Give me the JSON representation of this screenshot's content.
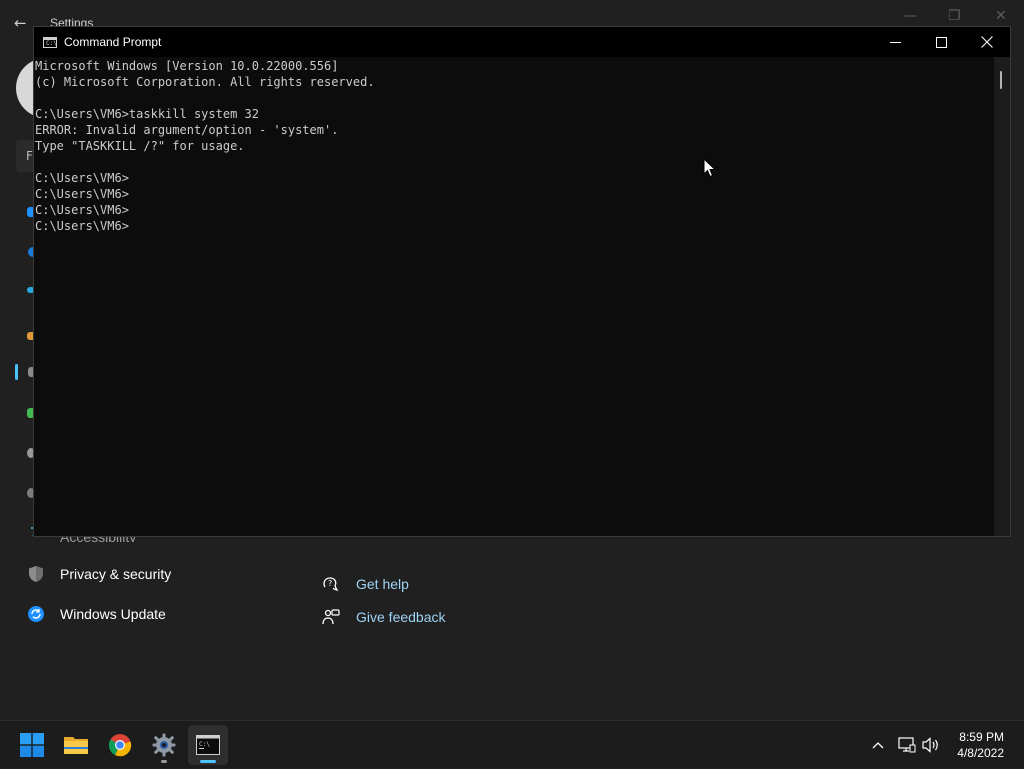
{
  "settings": {
    "title": "Settings",
    "nav": {
      "accessibility_partial": "Accessibility",
      "privacy": "Privacy & security",
      "windows_update": "Windows Update"
    },
    "find_placeholder": "F",
    "help": {
      "get_help": "Get help",
      "give_feedback": "Give feedback"
    }
  },
  "cmd": {
    "title": "Command Prompt",
    "icon_text": "C:\\",
    "lines": [
      "Microsoft Windows [Version 10.0.22000.556]",
      "(c) Microsoft Corporation. All rights reserved.",
      "",
      "C:\\Users\\VM6>taskkill system 32",
      "ERROR: Invalid argument/option - 'system'.",
      "Type \"TASKKILL /?\" for usage.",
      "",
      "C:\\Users\\VM6>",
      "C:\\Users\\VM6>",
      "C:\\Users\\VM6>",
      "C:\\Users\\VM6>"
    ]
  },
  "taskbar": {
    "apps": [
      "start",
      "file-explorer",
      "chrome",
      "settings",
      "command-prompt"
    ],
    "clock": {
      "time": "8:59 PM",
      "date": "4/8/2022"
    }
  },
  "colors": {
    "accent": "#4cc2ff",
    "link": "#9fd4f5"
  }
}
